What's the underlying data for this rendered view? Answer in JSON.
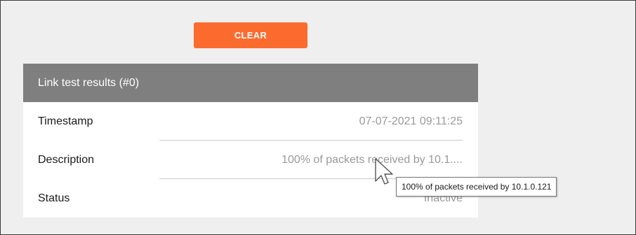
{
  "toolbar": {
    "clear_label": "CLEAR"
  },
  "card": {
    "title": "Link test results (#0)",
    "rows": [
      {
        "label": "Timestamp",
        "value": "07-07-2021 09:11:25"
      },
      {
        "label": "Description",
        "value": "100% of packets received by 10.1...."
      },
      {
        "label": "Status",
        "value": "Inactive"
      }
    ]
  },
  "tooltip": {
    "text": "100% of packets received by 10.1.0.121"
  },
  "cursor": {
    "icon": "arrow-pointer-icon"
  },
  "colors": {
    "accent": "#fc6b2e",
    "header_bg": "#7f7f7f",
    "page_bg": "#efefef",
    "value_text": "#9a9a9a"
  }
}
